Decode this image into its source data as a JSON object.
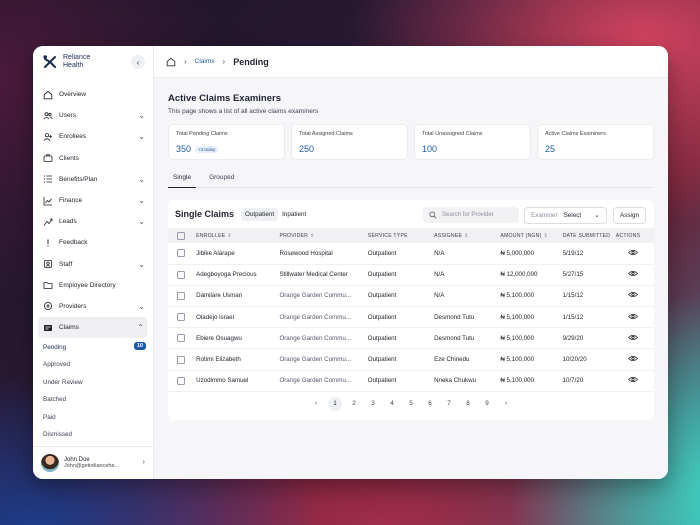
{
  "brand": {
    "line1": "Reliance",
    "line2": "Health"
  },
  "sidebar": {
    "items": [
      {
        "label": "Overview",
        "icon": "home-icon",
        "chevron": false
      },
      {
        "label": "Users",
        "icon": "users-icon",
        "chevron": true
      },
      {
        "label": "Enrollees",
        "icon": "enrollees-icon",
        "chevron": true
      },
      {
        "label": "Clients",
        "icon": "briefcase-icon",
        "chevron": false
      },
      {
        "label": "Benefits/Plan",
        "icon": "list-icon",
        "chevron": true
      },
      {
        "label": "Finance",
        "icon": "chart-icon",
        "chevron": true
      },
      {
        "label": "Leads",
        "icon": "leads-icon",
        "chevron": true
      },
      {
        "label": "Feedback",
        "icon": "feedback-icon",
        "chevron": false
      },
      {
        "label": "Staff",
        "icon": "staff-icon",
        "chevron": true
      },
      {
        "label": "Employee Directory",
        "icon": "folder-icon",
        "chevron": false
      },
      {
        "label": "Providers",
        "icon": "providers-icon",
        "chevron": true
      }
    ],
    "active": {
      "label": "Claims",
      "icon": "claims-icon"
    },
    "sub_items": [
      {
        "label": "Pending",
        "count": "10"
      },
      {
        "label": "Approved"
      },
      {
        "label": "Under Review"
      },
      {
        "label": "Batched"
      },
      {
        "label": "Paid"
      },
      {
        "label": "Dismissed"
      }
    ]
  },
  "user": {
    "name": "John Doe",
    "email": "John@getreliancehe..."
  },
  "breadcrumb": {
    "link": "Claims",
    "current": "Pending"
  },
  "page": {
    "title": "Active Claims Examiners",
    "subtitle": "This page shows a list of all active claims examiners"
  },
  "stats": [
    {
      "label": "Total Pending Claims",
      "value": "350",
      "pill": "+3 today"
    },
    {
      "label": "Total Assigned Claims",
      "value": "250"
    },
    {
      "label": "Total Unassigned Claims",
      "value": "100"
    },
    {
      "label": "Active Claims Examiners",
      "value": "25"
    }
  ],
  "tabs": [
    "Single",
    "Grouped"
  ],
  "panel": {
    "title": "Single Claims",
    "segments": [
      "Outpatient",
      "Inpatient"
    ],
    "search_placeholder": "Search for Provider",
    "examiner_label": "Examiner",
    "examiner_value": "Select",
    "assign_label": "Assign"
  },
  "table": {
    "headers": [
      "ENROLLEE",
      "PROVIDER",
      "SERVICE TYPE",
      "ASSIGNEE",
      "AMOUNT (NGN)",
      "DATE SUBMITTED",
      "ACTIONS"
    ],
    "rows": [
      {
        "enrollee": "Jibike Alarape",
        "provider": "Rosewood Hospital",
        "service": "Outpatient",
        "assignee": "N/A",
        "amount": "₦ 5,000,000",
        "date": "5/19/12"
      },
      {
        "enrollee": "Adegboyoga Precious",
        "provider": "Stillwater Medical Center",
        "service": "Outpatient",
        "assignee": "N/A",
        "amount": "₦ 12,000,000",
        "date": "5/27/15"
      },
      {
        "enrollee": "Damilare Usman",
        "provider": "Orange Garden Commu...",
        "service": "Outpatient",
        "assignee": "N/A",
        "amount": "₦ 5,100,000",
        "date": "1/15/12"
      },
      {
        "enrollee": "Oladejo israel",
        "provider": "Orange Garden Commu...",
        "service": "Outpatient",
        "assignee": "Desmond Tutu",
        "amount": "₦ 5,100,000",
        "date": "1/15/12"
      },
      {
        "enrollee": "Ebiere Osuagwu",
        "provider": "Orange Garden Commu...",
        "service": "Outpatient",
        "assignee": "Desmond Tutu",
        "amount": "₦ 5,100,000",
        "date": "9/29/20"
      },
      {
        "enrollee": "Rotimi Elizabeth",
        "provider": "Orange Garden Commu...",
        "service": "Outpatient",
        "assignee": "Eze Chinedu",
        "amount": "₦ 5,100,000",
        "date": "10/20/20"
      },
      {
        "enrollee": "Uzodimmo Samuel",
        "provider": "Orange Garden Commu...",
        "service": "Outpatient",
        "assignee": "Nneka Chukwu",
        "amount": "₦ 5,100,000",
        "date": "10/7/20"
      }
    ]
  },
  "pagination": {
    "pages": [
      "1",
      "2",
      "3",
      "4",
      "5",
      "6",
      "7",
      "8",
      "9"
    ],
    "current": "1",
    "prev": "‹",
    "next": "›"
  },
  "colors": {
    "accent": "#1e5aa8",
    "brand_dark": "#1b2a55"
  }
}
